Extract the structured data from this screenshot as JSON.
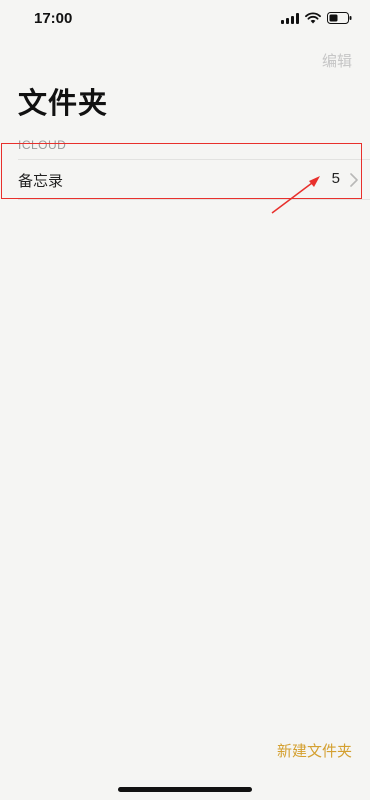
{
  "status_bar": {
    "time": "17:00"
  },
  "header": {
    "edit_label": "编辑",
    "title": "文件夹"
  },
  "section": {
    "label": "ICLOUD"
  },
  "folders": [
    {
      "name": "备忘录",
      "count": "5"
    }
  ],
  "footer": {
    "new_folder_label": "新建文件夹"
  },
  "colors": {
    "accent": "#d4a030",
    "annotation": "#e8302c"
  }
}
